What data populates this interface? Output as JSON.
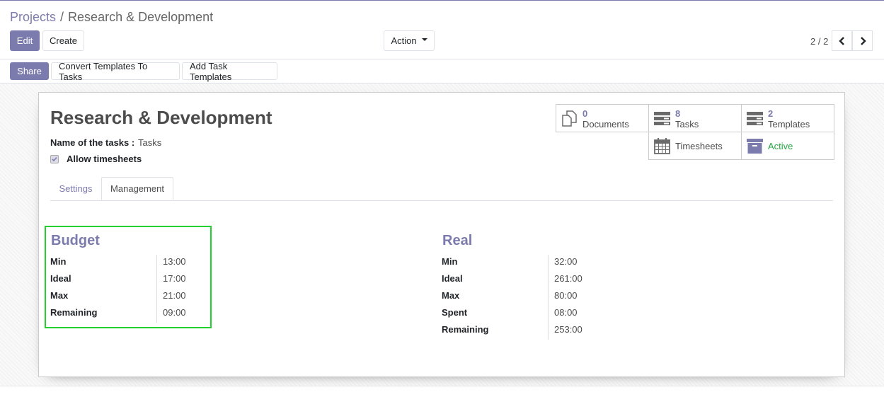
{
  "breadcrumb": {
    "parent": "Projects",
    "separator": "/",
    "current": "Research & Development"
  },
  "toolbar": {
    "edit_label": "Edit",
    "create_label": "Create",
    "action_label": "Action"
  },
  "pager": {
    "value": "2 / 2"
  },
  "statusbar": {
    "share_label": "Share",
    "convert_label": "Convert Templates To Tasks",
    "add_templates_label": "Add Task Templates"
  },
  "record": {
    "title": "Research & Development",
    "task_name_label": "Name of the tasks :",
    "task_name_value": "Tasks",
    "allow_timesheets_label": "Allow timesheets",
    "allow_timesheets_checked": true
  },
  "smart_buttons": {
    "documents": {
      "count": "0",
      "label": "Documents",
      "icon": "documents-icon"
    },
    "tasks": {
      "count": "8",
      "label": "Tasks",
      "icon": "tasks-icon"
    },
    "templates": {
      "count": "2",
      "label": "Templates",
      "icon": "templates-icon"
    },
    "timesheets": {
      "label": "Timesheets",
      "icon": "calendar-icon"
    },
    "active": {
      "label": "Active",
      "icon": "archive-icon",
      "color": "#28a745"
    }
  },
  "tabs": {
    "settings": "Settings",
    "management": "Management",
    "active": "Management"
  },
  "budget": {
    "title": "Budget",
    "rows": [
      {
        "label": "Min",
        "value": "13:00"
      },
      {
        "label": "Ideal",
        "value": "17:00"
      },
      {
        "label": "Max",
        "value": "21:00"
      },
      {
        "label": "Remaining",
        "value": "09:00"
      }
    ]
  },
  "real": {
    "title": "Real",
    "rows": [
      {
        "label": "Min",
        "value": "32:00"
      },
      {
        "label": "Ideal",
        "value": "261:00"
      },
      {
        "label": "Max",
        "value": "80:00"
      },
      {
        "label": "Spent",
        "value": "08:00"
      },
      {
        "label": "Remaining",
        "value": "253:00"
      }
    ]
  },
  "colors": {
    "brand": "#7c7bad",
    "active_status": "#28a745",
    "highlight_border": "#22d12e"
  }
}
